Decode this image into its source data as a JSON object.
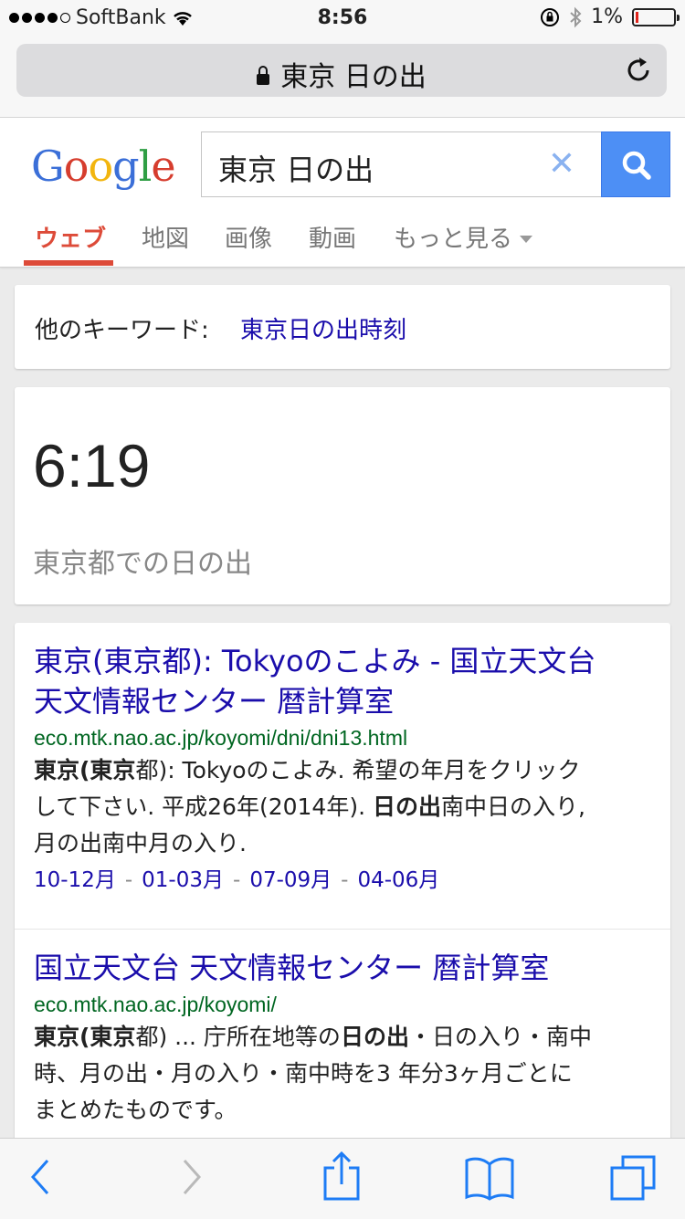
{
  "status": {
    "carrier": "SoftBank",
    "time": "8:56",
    "battery": "1%"
  },
  "browser": {
    "url_title": "東京 日の出"
  },
  "google": {
    "logo": "Google",
    "query": "東京 日の出",
    "tabs": [
      {
        "label": "ウェブ"
      },
      {
        "label": "地図"
      },
      {
        "label": "画像"
      },
      {
        "label": "動画"
      },
      {
        "label": "もっと見る"
      }
    ]
  },
  "related": {
    "label": "他のキーワード:",
    "link": "東京日の出時刻"
  },
  "answer": {
    "time": "6:19",
    "caption": "東京都での日の出"
  },
  "results": [
    {
      "title_line1": "東京(東京都): Tokyoのこよみ - 国立天文台",
      "title_line2": "天文情報センター 暦計算室",
      "url": "eco.mtk.nao.ac.jp/koyomi/dni/dni13.html",
      "s1a": "東京(東京",
      "s1b": "都): Tokyoのこよみ. 希望の年月をクリック",
      "s2a": "して下さい. 平成26年(2014年). ",
      "s2b": "日の出",
      "s2c": "南中日の入り,",
      "s3": "月の出南中月の入り.",
      "sitelinks": [
        "10-12月",
        "01-03月",
        "07-09月",
        "04-06月"
      ]
    },
    {
      "title_line1": "国立天文台 天文情報センター 暦計算室",
      "url": "eco.mtk.nao.ac.jp/koyomi/",
      "s1a": "東京(東京",
      "s1b": "都) ... 庁所在地等の",
      "s1c": "日の出",
      "s1d": "・日の入り・南中",
      "s2": "時、月の出・月の入り・南中時を3 年分3ヶ月ごとに",
      "s3": "まとめたものです。"
    }
  ],
  "colors": {
    "link": "#1a0dab",
    "url": "#006621",
    "accent": "#dd4b39",
    "search_button": "#4d8ff5"
  },
  "toolbar_icons": [
    "back-icon",
    "forward-icon",
    "share-icon",
    "bookmarks-icon",
    "tabs-icon"
  ]
}
